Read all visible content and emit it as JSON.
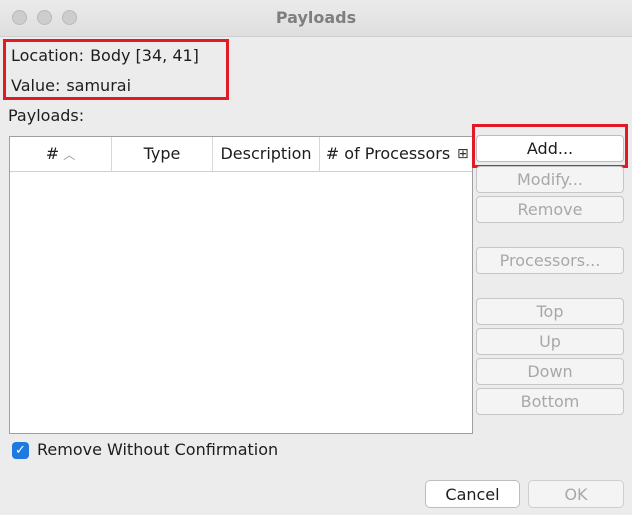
{
  "window": {
    "title": "Payloads"
  },
  "info": {
    "location_label": "Location:",
    "location_value": "Body [34, 41]",
    "value_label": "Value:",
    "value_value": "samurai"
  },
  "payloads_label": "Payloads:",
  "table": {
    "columns": [
      {
        "label": "#",
        "sort": "ascending"
      },
      {
        "label": "Type"
      },
      {
        "label": "Description"
      },
      {
        "label": "# of Processors"
      }
    ],
    "rows": []
  },
  "buttons": {
    "add": "Add...",
    "modify": "Modify...",
    "remove": "Remove",
    "processors": "Processors...",
    "top": "Top",
    "up": "Up",
    "down": "Down",
    "bottom": "Bottom"
  },
  "options": {
    "remove_without_confirmation": {
      "label": "Remove Without Confirmation",
      "checked": true
    }
  },
  "footer": {
    "cancel": "Cancel",
    "ok": "OK"
  },
  "colors": {
    "highlight": "#e01b24",
    "checkbox": "#1f7ae0"
  }
}
